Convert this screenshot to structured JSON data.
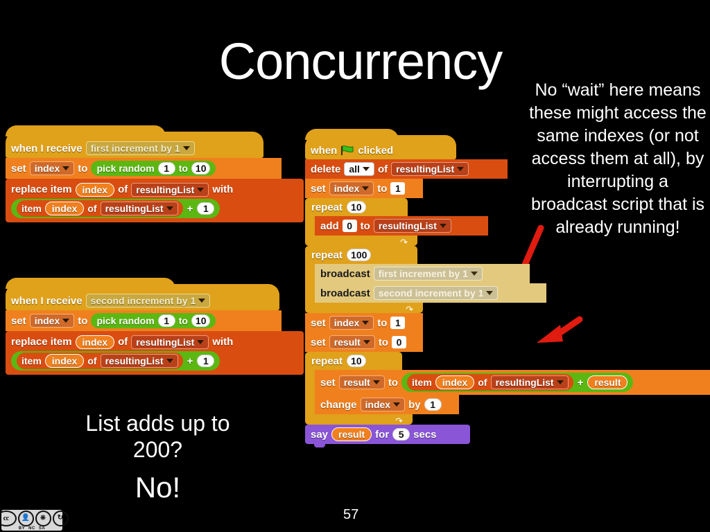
{
  "slide": {
    "title": "Concurrency",
    "page_number": "57",
    "note": "No “wait” here means these might access the same indexes (or not access them at all), by interrupting a broadcast script that is already running!",
    "verdict_question": "List adds up to 200?",
    "verdict_answer": "No!",
    "license": {
      "cc": "cc",
      "by": "BY",
      "nc": "NC",
      "sa": "SA"
    },
    "colors": {
      "background": "#000000",
      "text": "#ffffff",
      "arrow": "#e01b10",
      "control": "#e0a11b",
      "control_light": "#e3c97e",
      "variables": "#f0801e",
      "list": "#d94d11",
      "operators": "#5cb712",
      "looks": "#8a55d7"
    }
  },
  "script_first": {
    "hat": {
      "when": "when I receive",
      "message": "first increment by 1"
    },
    "set": {
      "set": "set",
      "var": "index",
      "to": "to"
    },
    "pick": {
      "label": "pick random",
      "from": "1",
      "join": "to",
      "upto": "10"
    },
    "replace": {
      "label": "replace item",
      "index": "index",
      "of": "of",
      "list": "resultingList",
      "with": "with"
    },
    "item": {
      "label": "item",
      "index": "index",
      "of": "of",
      "list": "resultingList",
      "plus": "+",
      "amount": "1"
    }
  },
  "script_second": {
    "hat": {
      "when": "when I receive",
      "message": "second increment by 1"
    },
    "set": {
      "set": "set",
      "var": "index",
      "to": "to"
    },
    "pick": {
      "label": "pick random",
      "from": "1",
      "join": "to",
      "upto": "10"
    },
    "replace": {
      "label": "replace item",
      "index": "index",
      "of": "of",
      "list": "resultingList",
      "with": "with"
    },
    "item": {
      "label": "item",
      "index": "index",
      "of": "of",
      "list": "resultingList",
      "plus": "+",
      "amount": "1"
    }
  },
  "script_main": {
    "hat": {
      "when": "when",
      "icon": "green-flag-icon",
      "clicked": "clicked"
    },
    "delete": {
      "label": "delete",
      "which": "all",
      "of": "of",
      "list": "resultingList"
    },
    "set_index_1": {
      "set": "set",
      "var": "index",
      "to": "to",
      "value": "1"
    },
    "repeat_10_a": {
      "label": "repeat",
      "times": "10"
    },
    "add": {
      "label": "add",
      "value": "0",
      "to": "to",
      "list": "resultingList"
    },
    "repeat_100": {
      "label": "repeat",
      "times": "100"
    },
    "broadcast_first": {
      "label": "broadcast",
      "message": "first increment by 1"
    },
    "broadcast_second": {
      "label": "broadcast",
      "message": "second increment by 1"
    },
    "set_index_1b": {
      "set": "set",
      "var": "index",
      "to": "to",
      "value": "1"
    },
    "set_result_0": {
      "set": "set",
      "var": "result",
      "to": "to",
      "value": "0"
    },
    "repeat_10_b": {
      "label": "repeat",
      "times": "10"
    },
    "set_result_sum": {
      "set": "set",
      "var": "result",
      "to": "to"
    },
    "item": {
      "label": "item",
      "index": "index",
      "of": "of",
      "list": "resultingList",
      "plus": "+",
      "result": "result"
    },
    "change_index": {
      "label": "change",
      "var": "index",
      "by": "by",
      "value": "1"
    },
    "say": {
      "label": "say",
      "value": "result",
      "for": "for",
      "secs_value": "5",
      "secs": "secs"
    }
  }
}
